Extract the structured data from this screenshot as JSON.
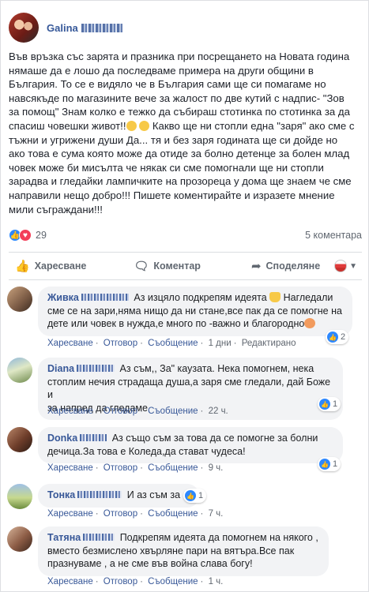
{
  "post": {
    "author": "Galina",
    "text_lines": [
      "Във връзка със зарята и празника при посрещането на Новата година",
      "нямаше да е лошо да последваме примера на други общини в",
      "България. То се е видяло че в България сами ще си помагаме но",
      "навсякъде по магазините вече за жалост по две кутий с надпис- \"Зов",
      "за помощ\" Знам колко е тежко да събираш стотинка по стотинка за да",
      "спасиш човешки живот!!",
      " Какво ще ни стопли една \"заря\" ако сме с",
      "тъжни и угрижени души Да... тя и без заря годината ще си дойде но",
      "ако това е сума която може да отиде за болно детенце за болен млад",
      "човек може би мисълта че някак си сме помогнали ще ни стопли",
      "зарадва и гледайки лампичките на прозореца у дома ще знаем че сме",
      "направили нещо добро!!! Пишете коментирайте и изразете мнение",
      "мили съграждани!!!"
    ],
    "reaction_count": "29",
    "comments_count": "5 коментара"
  },
  "actions": {
    "like": "Харесване",
    "comment": "Коментар",
    "share": "Споделяне"
  },
  "comments": [
    {
      "name": "Живка",
      "text_a": "Аз изцяло подкрепям идеята",
      "text_b": " Нагледали",
      "line2": "сме се на зари,няма нищо да ни стане,все пак да се помогне на",
      "line3": "дете или човек в нужда,е много по -важно и благородно",
      "meta": {
        "like": "Харесване",
        "reply": "Отговор",
        "message": "Съобщение",
        "time": "1 дни",
        "edited": "Редактирано"
      },
      "reactions": "2"
    },
    {
      "name": "Diana",
      "text_a": "Аз съм,, За\" каузата. Нека помогнем, нека",
      "line2": "стоплим нечия страдаща душа,а заря сме гледали, дай Боже и",
      "line3": "за напред да гледаме",
      "meta": {
        "like": "Харесване",
        "reply": "Отговор",
        "message": "Съобщение",
        "time": "22 ч."
      },
      "reactions": "1"
    },
    {
      "name": "Donka",
      "text_a": "Аз също съм за това да се помогне за болни",
      "line2": "дечица.За това е Коледа,да стават чудеса!",
      "meta": {
        "like": "Харесване",
        "reply": "Отговор",
        "message": "Съобщение",
        "time": "9 ч."
      },
      "reactions": "1"
    },
    {
      "name": "Тонка",
      "text_a": "И аз съм за",
      "meta": {
        "like": "Харесване",
        "reply": "Отговор",
        "message": "Съобщение",
        "time": "7 ч."
      },
      "reactions": "1"
    },
    {
      "name": "Татяна",
      "text_a": "Подкрепям идеята да помогнем на някого ,",
      "line2": "вместо безмислено хвърляне пари на вятъра.Все пак",
      "line3": "празнуваме , а не сме във война слава богу!",
      "meta": {
        "like": "Харесване",
        "reply": "Отговор",
        "message": "Съобщение",
        "time": "1 ч."
      },
      "reactions": ""
    }
  ],
  "colors": {
    "link": "#385898",
    "like_blue": "#2d88ff",
    "love_red": "#f33e58",
    "bubble_bg": "#f2f3f5"
  }
}
